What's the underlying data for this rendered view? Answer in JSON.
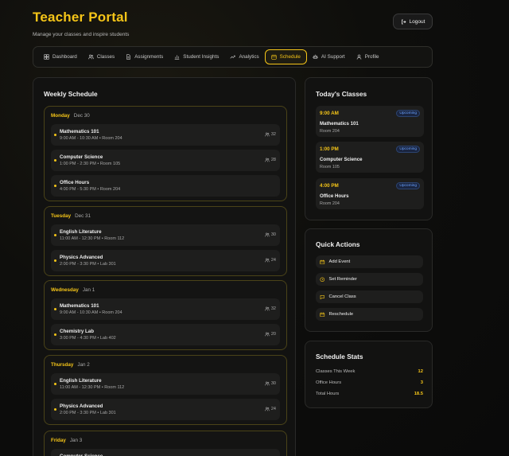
{
  "header": {
    "title": "Teacher Portal",
    "subtitle": "Manage your classes and inspire students",
    "logout_label": "Logout"
  },
  "nav": [
    {
      "label": "Dashboard",
      "icon": "dashboard-icon"
    },
    {
      "label": "Classes",
      "icon": "users-icon"
    },
    {
      "label": "Assignments",
      "icon": "document-icon"
    },
    {
      "label": "Student Insights",
      "icon": "bar-chart-icon"
    },
    {
      "label": "Analytics",
      "icon": "trend-icon"
    },
    {
      "label": "Schedule",
      "icon": "calendar-icon",
      "active": true
    },
    {
      "label": "AI Support",
      "icon": "robot-icon"
    },
    {
      "label": "Profile",
      "icon": "user-icon"
    }
  ],
  "weekly": {
    "title": "Weekly Schedule",
    "days": [
      {
        "name": "Monday",
        "date": "Dec 30",
        "classes": [
          {
            "name": "Mathematics 101",
            "meta": "9:00 AM - 10:30 AM • Room 204",
            "count": "32"
          },
          {
            "name": "Computer Science",
            "meta": "1:00 PM - 2:30 PM • Room 105",
            "count": "28"
          },
          {
            "name": "Office Hours",
            "meta": "4:00 PM - 5:30 PM • Room 204",
            "count": ""
          }
        ]
      },
      {
        "name": "Tuesday",
        "date": "Dec 31",
        "classes": [
          {
            "name": "English Literature",
            "meta": "11:00 AM - 12:30 PM • Room 112",
            "count": "30"
          },
          {
            "name": "Physics Advanced",
            "meta": "2:00 PM - 3:30 PM • Lab 301",
            "count": "24"
          }
        ]
      },
      {
        "name": "Wednesday",
        "date": "Jan 1",
        "classes": [
          {
            "name": "Mathematics 101",
            "meta": "9:00 AM - 10:30 AM • Room 204",
            "count": "32"
          },
          {
            "name": "Chemistry Lab",
            "meta": "3:00 PM - 4:30 PM • Lab 402",
            "count": "20"
          }
        ]
      },
      {
        "name": "Thursday",
        "date": "Jan 2",
        "classes": [
          {
            "name": "English Literature",
            "meta": "11:00 AM - 12:30 PM • Room 112",
            "count": "30"
          },
          {
            "name": "Physics Advanced",
            "meta": "2:00 PM - 3:30 PM • Lab 301",
            "count": "24"
          }
        ]
      },
      {
        "name": "Friday",
        "date": "Jan 3",
        "classes": [
          {
            "name": "Computer Science",
            "meta": "",
            "count": ""
          }
        ]
      }
    ]
  },
  "today": {
    "title": "Today's Classes",
    "items": [
      {
        "time": "9:00 AM",
        "badge": "Upcoming",
        "name": "Mathematics 101",
        "room": "Room 204"
      },
      {
        "time": "1:00 PM",
        "badge": "Upcoming",
        "name": "Computer Science",
        "room": "Room 105"
      },
      {
        "time": "4:00 PM",
        "badge": "Upcoming",
        "name": "Office Hours",
        "room": "Room 204"
      }
    ]
  },
  "quick": {
    "title": "Quick Actions",
    "actions": [
      {
        "label": "Add Event",
        "icon": "calendar-plus-icon"
      },
      {
        "label": "Set Reminder",
        "icon": "clock-icon"
      },
      {
        "label": "Cancel Class",
        "icon": "message-icon"
      },
      {
        "label": "Reschedule",
        "icon": "calendar-icon"
      }
    ]
  },
  "stats": {
    "title": "Schedule Stats",
    "rows": [
      {
        "label": "Classes This Week",
        "value": "12"
      },
      {
        "label": "Office Hours",
        "value": "3"
      },
      {
        "label": "Total Hours",
        "value": "18.5"
      }
    ]
  },
  "colors": {
    "accent": "#f5c518",
    "badge": "#6aa3ff"
  }
}
